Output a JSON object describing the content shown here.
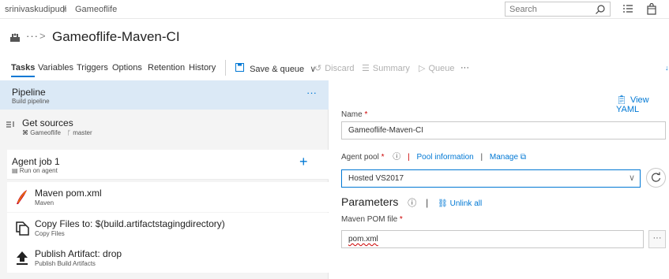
{
  "breadcrumb": {
    "org": "srinivaskudipudi",
    "separator": "/",
    "project": "Gameoflife"
  },
  "search": {
    "placeholder": "Search"
  },
  "page": {
    "title": "Gameoflife-Maven-CI",
    "nav_more": "···",
    "nav_chevron": ">"
  },
  "tabs": [
    {
      "label": "Tasks",
      "active": true
    },
    {
      "label": "Variables"
    },
    {
      "label": "Triggers"
    },
    {
      "label": "Options"
    },
    {
      "label": "Retention"
    },
    {
      "label": "History"
    }
  ],
  "toolbar": {
    "save_queue": "Save & queue",
    "save_chevron": "∨",
    "discard": "Discard",
    "summary": "Summary",
    "queue": "Queue",
    "more": "···"
  },
  "pipeline": {
    "title": "Pipeline",
    "subtitle": "Build pipeline",
    "more": "···"
  },
  "get_sources": {
    "title": "Get sources",
    "repo": "Gameoflife",
    "branch": "master"
  },
  "agent_job": {
    "title": "Agent job 1",
    "subtitle": "Run on agent",
    "add": "+"
  },
  "tasks": [
    {
      "title": "Maven pom.xml",
      "subtitle": "Maven",
      "icon": "maven-icon"
    },
    {
      "title": "Copy Files to: $(build.artifactstagingdirectory)",
      "subtitle": "Copy Files",
      "icon": "copy-files-icon"
    },
    {
      "title": "Publish Artifact: drop",
      "subtitle": "Publish Build Artifacts",
      "icon": "publish-artifact-icon"
    }
  ],
  "details": {
    "view_yaml": "View YAML",
    "name_label": "Name",
    "name_value": "Gameoflife-Maven-CI",
    "agent_pool_label": "Agent pool",
    "pool_information": "Pool information",
    "manage": "Manage",
    "agent_pool_value": "Hosted VS2017",
    "parameters": "Parameters",
    "unlink_all": "Unlink all",
    "pom_label": "Maven POM file",
    "pom_value": "pom.xml",
    "more": "···",
    "required_mark": "*",
    "separator": "|"
  },
  "colors": {
    "accent": "#0078d4",
    "selected_bg": "#dbe9f6",
    "required": "#cc0000"
  }
}
